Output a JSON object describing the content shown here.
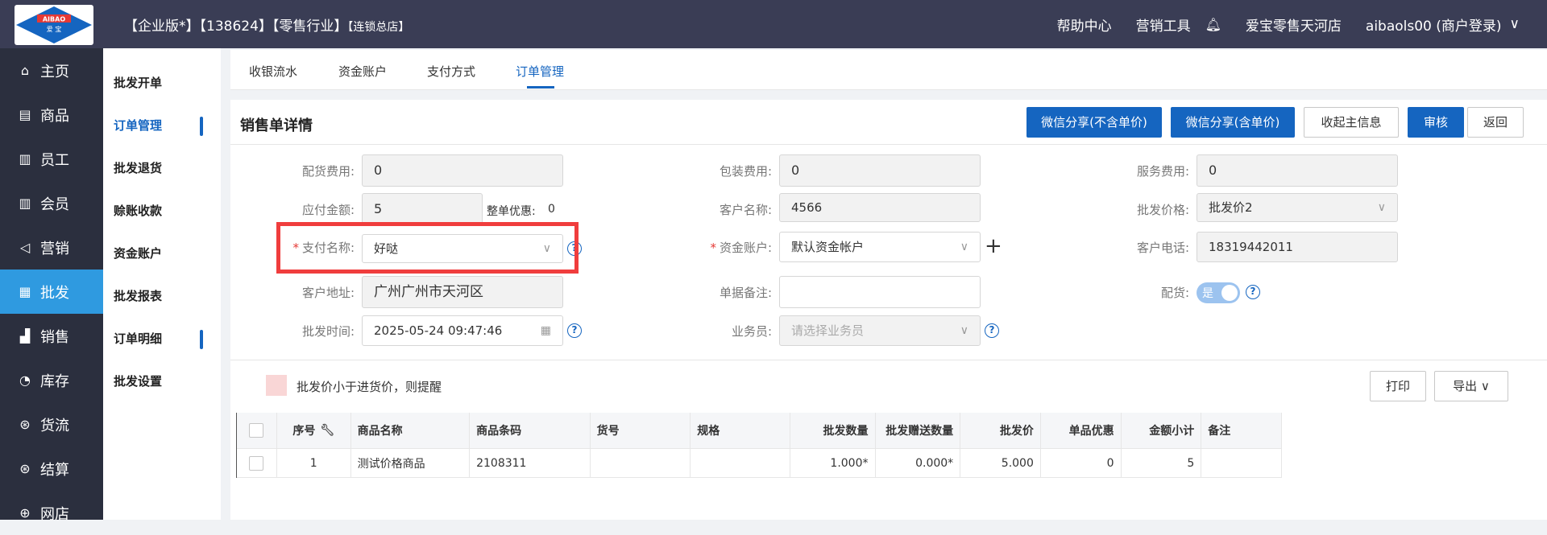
{
  "header": {
    "logo_text_top": "AIBAO",
    "logo_text_bottom": "爱 宝",
    "title_main": "【企业版*】【138624】【零售行业】",
    "title_sub": "【连锁总店】",
    "help": "帮助中心",
    "marketing": "营销工具",
    "store": "爱宝零售天河店",
    "user": "aibaols00 (商户登录)",
    "icons": {
      "bell": "bell-icon",
      "chevron": "chevron-down-icon"
    }
  },
  "sidebar": {
    "items": [
      {
        "label": "主页",
        "icon": "home-icon"
      },
      {
        "label": "商品",
        "icon": "goods-icon"
      },
      {
        "label": "员工",
        "icon": "staff-icon"
      },
      {
        "label": "会员",
        "icon": "member-icon"
      },
      {
        "label": "营销",
        "icon": "megaphone-icon"
      },
      {
        "label": "批发",
        "icon": "wholesale-icon"
      },
      {
        "label": "销售",
        "icon": "chart-icon"
      },
      {
        "label": "库存",
        "icon": "pie-icon"
      },
      {
        "label": "货流",
        "icon": "flow-icon"
      },
      {
        "label": "结算",
        "icon": "settle-icon"
      },
      {
        "label": "网店",
        "icon": "shop-icon"
      }
    ],
    "active_index": 5,
    "active_color": "#2f9ae0"
  },
  "subnav": {
    "items": [
      "批发开单",
      "订单管理",
      "批发退货",
      "赊账收款",
      "资金账户",
      "批发报表",
      "订单明细",
      "批发设置"
    ]
  },
  "tabs": [
    "收银流水",
    "资金账户",
    "支付方式",
    "订单管理"
  ],
  "panel": {
    "title": "销售单详情",
    "buttons": [
      "微信分享(不含单价)",
      "微信分享(含单价)",
      "收起主信息",
      "审核",
      "返回"
    ]
  },
  "form": {
    "delivery_fee": {
      "label": "配货费用:",
      "value": "0"
    },
    "package_fee": {
      "label": "包装费用:",
      "value": "0"
    },
    "service_fee": {
      "label": "服务费用:",
      "value": "0"
    },
    "payable": {
      "label": "应付金额:",
      "value": "5"
    },
    "discount": {
      "label": "整单优惠:",
      "value": "0"
    },
    "customer_name": {
      "label": "客户名称:",
      "value": "4566"
    },
    "price_level": {
      "label": "批发价格:",
      "value": "批发价2"
    },
    "pay_name": {
      "label": "支付名称:",
      "value": "好哒"
    },
    "fund_account": {
      "label": "资金账户:",
      "value": "默认资金帐户"
    },
    "customer_phone": {
      "label": "客户电话:",
      "value": "18319442011"
    },
    "customer_address": {
      "label": "客户地址:",
      "value": "广州广州市天河区"
    },
    "remark": {
      "label": "单据备注:",
      "value": ""
    },
    "delivery_toggle": {
      "label": "配货:",
      "value": "是"
    },
    "wholesale_time": {
      "label": "批发时间:",
      "value": "2025-05-24 09:47:46"
    },
    "salesman": {
      "label": "业务员:",
      "placeholder": "请选择业务员"
    },
    "required_mark": "*",
    "help_glyph": "?"
  },
  "hint": "批发价小于进货价，则提醒",
  "actions": {
    "print": "打印",
    "export": "导出"
  },
  "table": {
    "headers": [
      "序号",
      "商品名称",
      "商品条码",
      "货号",
      "规格",
      "批发数量",
      "批发赠送数量",
      "批发价",
      "单品优惠",
      "金额小计",
      "备注"
    ],
    "rows": [
      [
        "1",
        "测试价格商品",
        "2108311",
        "",
        "",
        "1.000*",
        "0.000*",
        "5.000",
        "0",
        "5",
        ""
      ]
    ]
  }
}
